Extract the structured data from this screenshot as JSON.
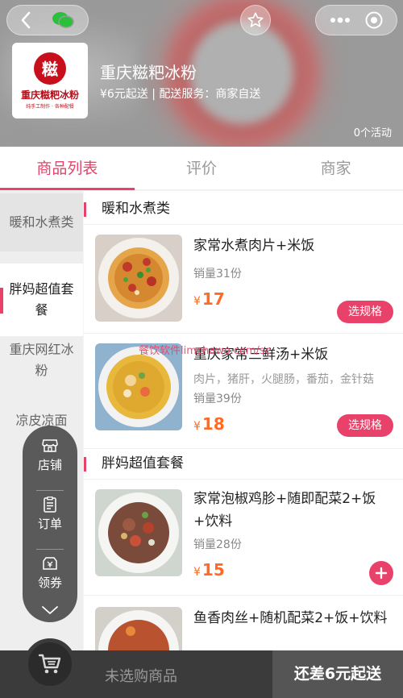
{
  "store": {
    "name": "重庆糍粑冰粉",
    "meta": "¥6元起送 | 配送服务：商家自送",
    "activity": "0个活动",
    "logo_text": "重庆糍粑冰粉",
    "logo_sub": "纯手工制作 · 各种配餐",
    "logo_seal": "糍"
  },
  "tabs": [
    {
      "label": "商品列表",
      "active": true
    },
    {
      "label": "评价",
      "active": false
    },
    {
      "label": "商家",
      "active": false
    }
  ],
  "categories": [
    {
      "label": "暖和水煮类"
    },
    {
      "label": "胖妈超值套餐"
    },
    {
      "label": "重庆网红冰粉"
    },
    {
      "label": "凉皮凉面"
    }
  ],
  "float_menu": [
    {
      "label": "店铺",
      "icon": "store-icon"
    },
    {
      "label": "订单",
      "icon": "order-icon"
    },
    {
      "label": "领券",
      "icon": "coupon-icon"
    }
  ],
  "sections": [
    {
      "title": "暖和水煮类",
      "items": [
        {
          "name": "家常水煮肉片+米饭",
          "desc": "",
          "sales": "销量31份",
          "currency": "¥",
          "price": "17",
          "action": "选规格"
        },
        {
          "name": "重庆家常三鲜汤+米饭",
          "desc": "肉片，猪肝，火腿肠，番茄，金针菇",
          "sales": "销量39份",
          "currency": "¥",
          "price": "18",
          "action": "选规格"
        }
      ]
    },
    {
      "title": "胖妈超值套餐",
      "items": [
        {
          "name": "家常泡椒鸡胗+随即配菜2+饭+饮料",
          "desc": "",
          "sales": "销量28份",
          "currency": "¥",
          "price": "15",
          "action": "+"
        },
        {
          "name": "鱼香肉丝+随机配菜2+饭+饮料",
          "desc": "",
          "sales": "",
          "currency": "",
          "price": "",
          "action": ""
        }
      ]
    }
  ],
  "watermark": "餐饮软件limchawo.com/sc",
  "cart": {
    "empty_text": "未选购商品",
    "gap_text": "还差6元起送"
  },
  "colors": {
    "accent": "#e8426a",
    "price": "#ff6a24"
  }
}
